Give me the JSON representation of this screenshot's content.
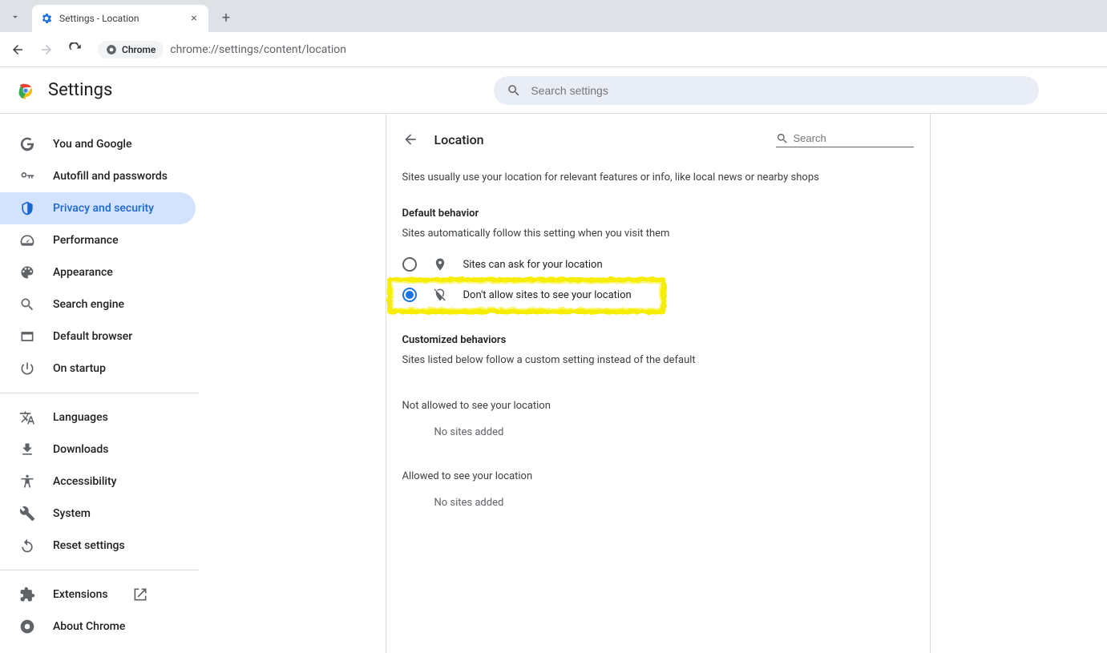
{
  "tab": {
    "title": "Settings - Location"
  },
  "toolbar": {
    "chrome_label": "Chrome",
    "url": "chrome://settings/content/location"
  },
  "header": {
    "title": "Settings",
    "search_placeholder": "Search settings"
  },
  "sidebar": {
    "items": [
      {
        "label": "You and Google"
      },
      {
        "label": "Autofill and passwords"
      },
      {
        "label": "Privacy and security"
      },
      {
        "label": "Performance"
      },
      {
        "label": "Appearance"
      },
      {
        "label": "Search engine"
      },
      {
        "label": "Default browser"
      },
      {
        "label": "On startup"
      }
    ],
    "items2": [
      {
        "label": "Languages"
      },
      {
        "label": "Downloads"
      },
      {
        "label": "Accessibility"
      },
      {
        "label": "System"
      },
      {
        "label": "Reset settings"
      }
    ],
    "items3": [
      {
        "label": "Extensions"
      },
      {
        "label": "About Chrome"
      }
    ]
  },
  "page": {
    "title": "Location",
    "search_placeholder": "Search",
    "top_desc": "Sites usually use your location for relevant features or info, like local news or nearby shops",
    "default_h": "Default behavior",
    "default_sub": "Sites automatically follow this setting when you visit them",
    "radio_ask": "Sites can ask for your location",
    "radio_dont": "Don't allow sites to see your location",
    "custom_h": "Customized behaviors",
    "custom_sub": "Sites listed below follow a custom setting instead of the default",
    "notallowed_h": "Not allowed to see your location",
    "notallowed_empty": "No sites added",
    "allowed_h": "Allowed to see your location",
    "allowed_empty": "No sites added"
  }
}
